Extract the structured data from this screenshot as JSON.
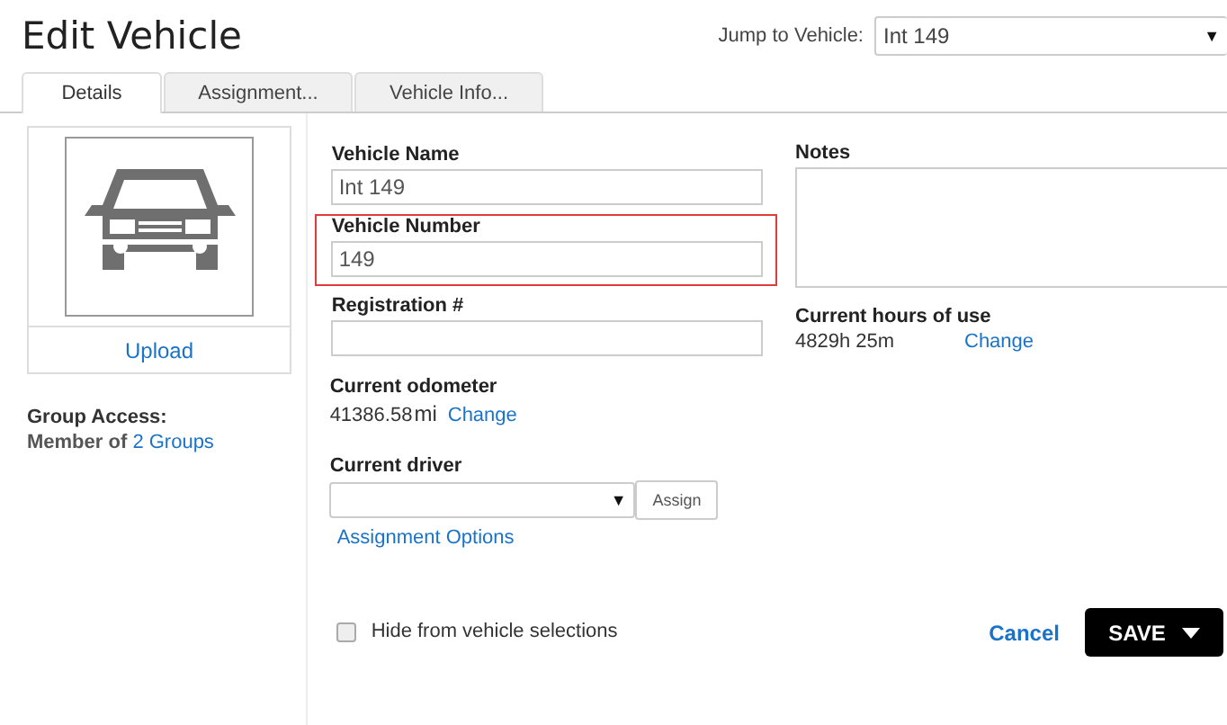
{
  "page": {
    "title": "Edit Vehicle"
  },
  "jump": {
    "label": "Jump to Vehicle:",
    "value": "Int 149",
    "arrow": "▼"
  },
  "tabs": [
    {
      "label": "Details",
      "selected": true
    },
    {
      "label": "Assignment...",
      "selected": false
    },
    {
      "label": "Vehicle Info...",
      "selected": false
    }
  ],
  "photo": {
    "upload": "Upload"
  },
  "group_access": {
    "label": "Group Access:",
    "text": "Member of",
    "link": "2 Groups"
  },
  "fields": [
    {
      "label": "Vehicle Name",
      "value": "Int 149",
      "highlighted": false
    },
    {
      "label": "Vehicle Number",
      "value": "149",
      "highlighted": true
    },
    {
      "label": "Registration #",
      "highlighted": false
    }
  ],
  "odometer": {
    "label": "Current odometer",
    "value": "41386.58",
    "unit": "mi",
    "link": "Change"
  },
  "driver": {
    "label": "Current driver",
    "arrow": "▼",
    "button": "Assign",
    "link": "Assignment Options"
  },
  "hide": {
    "label": "Hide from vehicle selections",
    "checked": false
  },
  "notes": {
    "label": "Notes"
  },
  "hours": {
    "label": "Current hours of use",
    "value": "4829h 25m",
    "link": "Change"
  },
  "actions": {
    "cancel": "Cancel",
    "save": "SAVE"
  }
}
